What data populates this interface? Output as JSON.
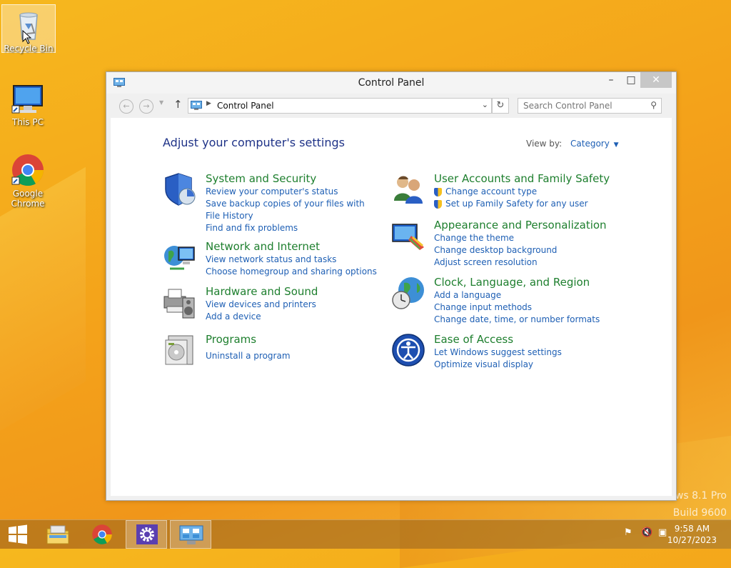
{
  "desktop": {
    "icons": [
      {
        "label": "Recycle Bin"
      },
      {
        "label": "This PC"
      },
      {
        "label": "Google Chrome"
      }
    ],
    "watermark_line1": "ws 8.1 Pro",
    "watermark_line2": "Build 9600"
  },
  "window": {
    "title": "Control Panel",
    "minimize_label": "–",
    "maximize_label": "□",
    "close_label": "✕"
  },
  "addressbar": {
    "path": "Control Panel",
    "search_placeholder": "Search Control Panel"
  },
  "main": {
    "heading": "Adjust your computer's settings",
    "view_by_label": "View by:",
    "view_by_value": "Category",
    "categories": [
      {
        "title": "System and Security",
        "links": [
          "Review your computer's status",
          "Save backup copies of your files with File History",
          "Find and fix problems"
        ]
      },
      {
        "title": "Network and Internet",
        "links": [
          "View network status and tasks",
          "Choose homegroup and sharing options"
        ]
      },
      {
        "title": "Hardware and Sound",
        "links": [
          "View devices and printers",
          "Add a device"
        ]
      },
      {
        "title": "Programs",
        "links": [
          "Uninstall a program"
        ]
      },
      {
        "title": "User Accounts and Family Safety",
        "links": [
          "Change account type",
          "Set up Family Safety for any user"
        ]
      },
      {
        "title": "Appearance and Personalization",
        "links": [
          "Change the theme",
          "Change desktop background",
          "Adjust screen resolution"
        ]
      },
      {
        "title": "Clock, Language, and Region",
        "links": [
          "Add a language",
          "Change input methods",
          "Change date, time, or number formats"
        ]
      },
      {
        "title": "Ease of Access",
        "links": [
          "Let Windows suggest settings",
          "Optimize visual display"
        ]
      }
    ]
  },
  "taskbar": {
    "time": "9:58 AM",
    "date": "10/27/2023"
  },
  "colors": {
    "category_title": "#1e7f2e",
    "link": "#1e5fb4",
    "heading": "#1e3287"
  }
}
